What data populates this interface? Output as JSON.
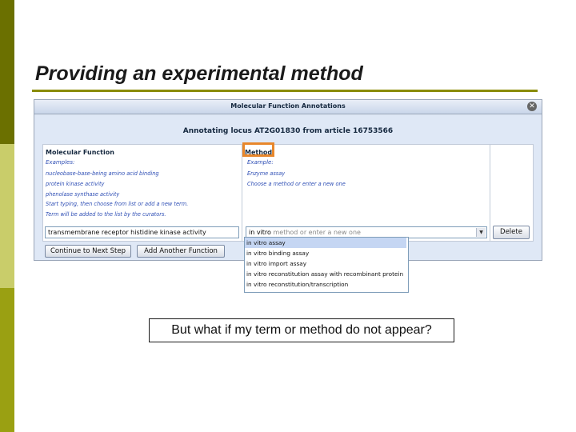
{
  "slide": {
    "title": "Providing an experimental method",
    "note": "But what if my term or method do not appear?"
  },
  "dialog": {
    "window_title": "Molecular Function Annotations",
    "close_icon": "close-icon",
    "heading": "Annotating locus AT2G01830 from article 16753566",
    "molecular_function": {
      "header": "Molecular Function",
      "examples_label": "Examples:",
      "examples": [
        "nucleobase-base-being amino acid binding",
        "protein kinase activity",
        "phenolase synthase activity",
        "Start typing, then choose from list or add a new term.",
        "Term will be added to the list by the curators."
      ],
      "input_value": "transmembrane receptor histidine kinase activity"
    },
    "method": {
      "header": "Method",
      "examples_label": "Example:",
      "examples": [
        "Enzyme assay",
        "Choose a method or enter a new one"
      ],
      "typed_value": "in vitro",
      "placeholder": "method or enter a new one",
      "options": [
        "in vitro assay",
        "in vitro binding assay",
        "in vitro import assay",
        "in vitro reconstitution assay with recombinant protein",
        "in vitro reconstitution/transcription"
      ],
      "selected_index": 0
    },
    "delete_label": "Delete",
    "continue_label": "Continue to Next Step",
    "add_label": "Add Another Function"
  },
  "colors": {
    "bar_dark": "#6b7000",
    "bar_light": "#c9cd6a",
    "bar_mid": "#9aa012",
    "highlight": "#e8872b",
    "link_blue": "#2f4fb5"
  }
}
